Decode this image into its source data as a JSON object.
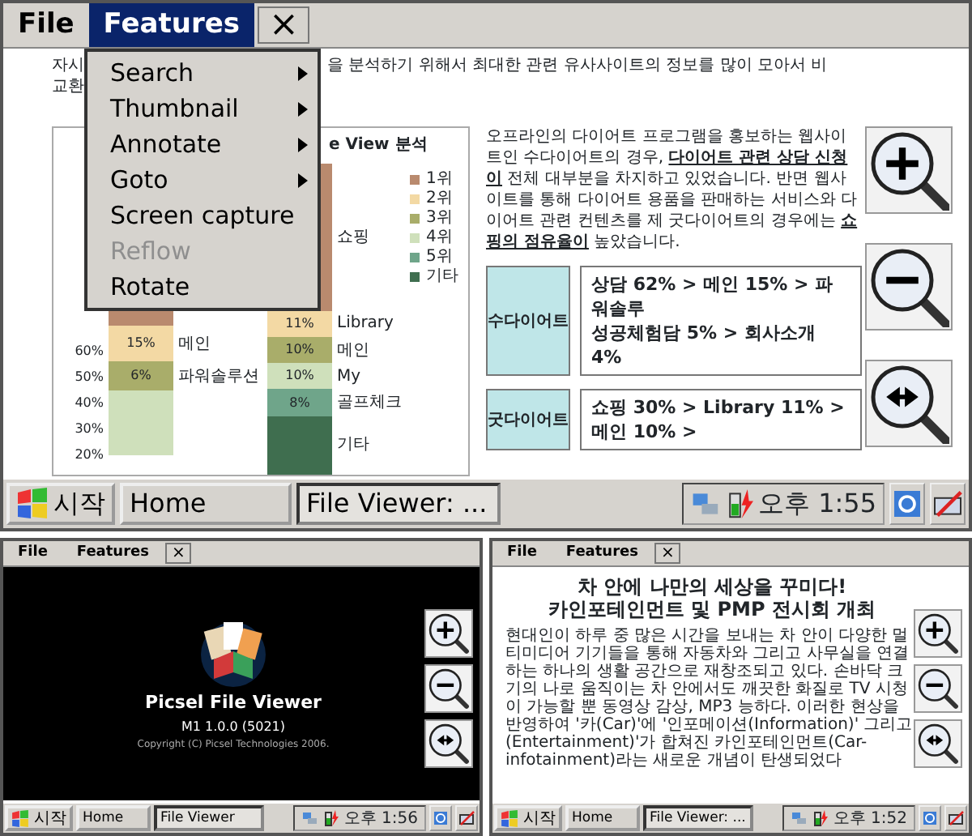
{
  "windows": [
    {
      "menu": [
        {
          "label": "File",
          "selected": false
        },
        {
          "label": "Features",
          "selected": true
        }
      ],
      "close": "×",
      "dropdown": [
        {
          "label": "Search",
          "submenu": true,
          "disabled": false
        },
        {
          "label": "Thumbnail",
          "submenu": true,
          "disabled": false
        },
        {
          "label": "Annotate",
          "submenu": true,
          "disabled": false
        },
        {
          "label": "Goto",
          "submenu": true,
          "disabled": false
        },
        {
          "label": "Screen capture",
          "submenu": false,
          "disabled": false
        },
        {
          "label": "Reflow",
          "submenu": false,
          "disabled": true
        },
        {
          "label": "Rotate",
          "submenu": false,
          "disabled": false
        }
      ],
      "content": {
        "kind": "report",
        "intro_left": [
          "자시",
          "교환"
        ],
        "intro_right": "을 분석하기 위해서 최대한 관련 유사사이트의 정보를 많이 모아서 비",
        "chart": {
          "title": "e View 분석",
          "yticks": [
            "60%",
            "50%",
            "40%",
            "30%",
            "20%"
          ],
          "legend": [
            {
              "label": "1위",
              "color": "#b98a6e"
            },
            {
              "label": "2위",
              "color": "#f3d9a4"
            },
            {
              "label": "3위",
              "color": "#a9ad6a"
            },
            {
              "label": "4위",
              "color": "#cfe0bb"
            },
            {
              "label": "5위",
              "color": "#6fa58a"
            },
            {
              "label": "기타",
              "color": "#3f6e4f"
            }
          ],
          "bars": [
            {
              "segments": [
                {
                  "color": "#b98a6e"
                },
                {
                  "value": "15%",
                  "name": "메인",
                  "color": "#f3d9a4"
                },
                {
                  "value": "6%",
                  "name": "파워솔루션",
                  "color": "#a9ad6a"
                },
                {
                  "color": "#cfe0bb"
                }
              ]
            },
            {
              "segments": [
                {
                  "name": "쇼핑",
                  "color": "#b98a6e"
                },
                {
                  "value": "11%",
                  "name": "Library",
                  "color": "#f3d9a4"
                },
                {
                  "value": "10%",
                  "name": "메인",
                  "color": "#a9ad6a"
                },
                {
                  "value": "10%",
                  "name": "My",
                  "color": "#cfe0bb"
                },
                {
                  "value": "8%",
                  "name": "골프체크",
                  "color": "#6fa58a"
                },
                {
                  "name": "기타",
                  "color": "#3f6e4f"
                }
              ]
            }
          ]
        },
        "paragraph": [
          "오프라인의 다이어트 프로그램을 홍보하는 웹사이트인",
          "수다이어트의 경우, **다이어트 관련 상담 신청이** 전체",
          "대부분을 차지하고 있었습니다. 반면 웹사이트를 통해 다이어트",
          "용품을 판매하는 서비스와 다이어트 관련 컨텐츠를 제",
          "굿다이어트의 경우에는 **쇼핑의 점유율이** 높았습니다."
        ],
        "boxes": [
          {
            "label": "수다이어트",
            "lines": [
              "상담 62% > 메인 15% > 파워솔루",
              "성공체험담 5% > 회사소개 4%"
            ]
          },
          {
            "label": "굿다이어트",
            "lines": [
              "쇼핑 30% > Library 11% > 메인 10% >"
            ]
          }
        ]
      },
      "taskbar": {
        "start": "시작",
        "buttons": [
          {
            "label": "Home",
            "selected": false
          },
          {
            "label": "File Viewer: ...",
            "selected": true
          }
        ],
        "clock": "오후 1:55"
      }
    },
    {
      "menu": [
        {
          "label": "File",
          "selected": false
        },
        {
          "label": "Features",
          "selected": false
        }
      ],
      "close": "×",
      "content": {
        "kind": "splash",
        "title": "Picsel File Viewer",
        "version": "M1 1.0.0 (5021)",
        "copyright": "Copyright (C) Picsel Technologies 2006."
      },
      "taskbar": {
        "start": "시작",
        "buttons": [
          {
            "label": "Home",
            "selected": false
          },
          {
            "label": "File Viewer",
            "selected": true
          }
        ],
        "clock": "오후 1:56"
      }
    },
    {
      "menu": [
        {
          "label": "File",
          "selected": false
        },
        {
          "label": "Features",
          "selected": false
        }
      ],
      "close": "×",
      "content": {
        "kind": "article",
        "title": [
          "차 안에 나만의 세상을 꾸미다!",
          "카인포테인먼트 및 PMP 전시회 개최"
        ],
        "body": [
          "현대인이 하루 중 많은 시간을 보내는 차 안이 다양한 멀티미디어 기기들을 통해 자동차와",
          "그리고 사무실을 연결하는 하나의 생활 공간으로 재창조되고 있다. 손바닥 크기의",
          "나로 움직이는 차 안에서도 깨끗한 화질로 TV 시청이 가능할 뿐 동영상 감상, MP3",
          "능하다. 이러한 현상을 반영하여 '카(Car)'에 '인포메이션(Information)' 그리고",
          "(Entertainment)'가 합쳐진 카인포테인먼트(Car-infotainment)라는 새로운 개념이 탄생되었다"
        ]
      },
      "taskbar": {
        "start": "시작",
        "buttons": [
          {
            "label": "Home",
            "selected": false
          },
          {
            "label": "File Viewer: ...",
            "selected": true
          }
        ],
        "clock": "오후 1:52"
      }
    }
  ]
}
